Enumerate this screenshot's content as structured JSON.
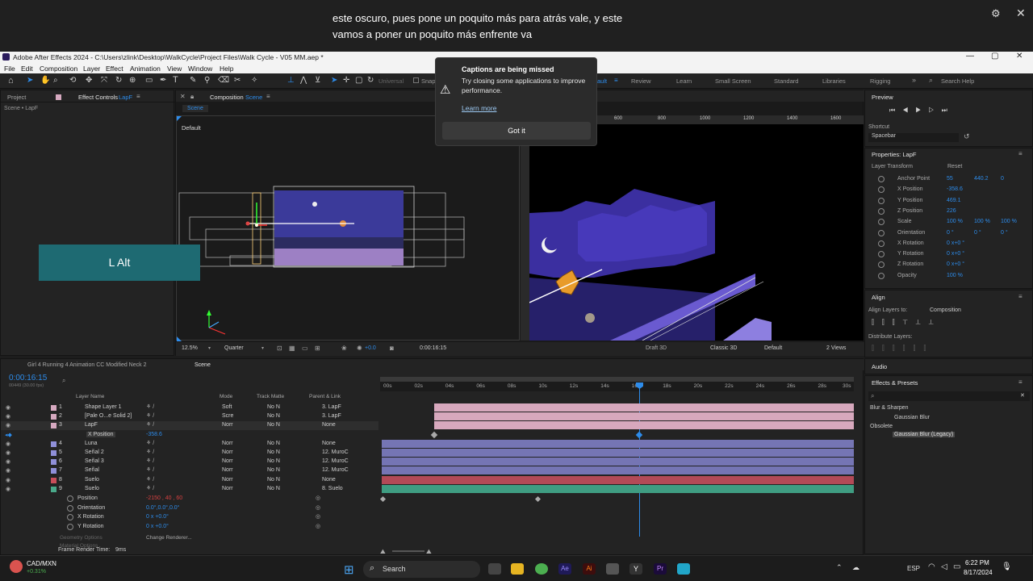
{
  "caption": {
    "line1": "este oscuro, pues pone un poquito más para atrás vale, y este",
    "line2": "vamos a poner un poquito más enfrente va"
  },
  "window": {
    "title": "Adobe After Effects 2024 - C:\\Users\\zlink\\Desktop\\WalkCycle\\Project Files\\Walk Cycle - V05 MM.aep *"
  },
  "menu": [
    "File",
    "Edit",
    "Composition",
    "Layer",
    "Effect",
    "Animation",
    "View",
    "Window",
    "Help"
  ],
  "toolbar": {
    "universal": "Universal",
    "snap": "Snap",
    "workspaces": [
      "ault",
      "Review",
      "Learn",
      "Small Screen",
      "Standard",
      "Libraries",
      "Rigging"
    ],
    "search_placeholder": "Search Help"
  },
  "notification": {
    "title": "Captions are being missed",
    "body": "Try closing some applications to improve performance.",
    "link": "Learn more",
    "button": "Got it"
  },
  "left_panel": {
    "tabs": [
      "Project",
      "Effect Controls"
    ],
    "effect_target": "LapF",
    "subtitle": "Scene • LapF"
  },
  "comp_panel": {
    "tab": "Composition",
    "tab_target": "Scene",
    "breadcrumb": "Scene",
    "view_label": "Default",
    "overlay_key": "L Alt",
    "zoom": "12.5%",
    "resolution": "Quarter",
    "exposure": "+0.0",
    "timecode": "0:00:16:15",
    "renderer_draft": "Draft 3D",
    "renderer": "Classic 3D",
    "camera": "Default",
    "views": "2 Views",
    "ruler_ticks": [
      "600",
      "800",
      "1000",
      "1200",
      "1400",
      "1600"
    ]
  },
  "preview": {
    "title": "Preview",
    "shortcut_label": "Shortcut",
    "shortcut_value": "Spacebar"
  },
  "properties": {
    "title": "Properties: LapF",
    "section": "Layer Transform",
    "reset": "Reset",
    "rows": [
      {
        "name": "Anchor Point",
        "v1": "55",
        "v2": "440.2",
        "v3": "0"
      },
      {
        "name": "X Position",
        "v1": "-358.6",
        "v2": "",
        "v3": ""
      },
      {
        "name": "Y Position",
        "v1": "469.1",
        "v2": "",
        "v3": ""
      },
      {
        "name": "Z Position",
        "v1": "226",
        "v2": "",
        "v3": ""
      },
      {
        "name": "Scale",
        "v1": "100 %",
        "v2": "100 %",
        "v3": "100 %"
      },
      {
        "name": "Orientation",
        "v1": "0 °",
        "v2": "0 °",
        "v3": "0 °"
      },
      {
        "name": "X Rotation",
        "v1": "0 x+0 °",
        "v2": "",
        "v3": ""
      },
      {
        "name": "Y Rotation",
        "v1": "0 x+0 °",
        "v2": "",
        "v3": ""
      },
      {
        "name": "Z Rotation",
        "v1": "0 x+0 °",
        "v2": "",
        "v3": ""
      },
      {
        "name": "Opacity",
        "v1": "100 %",
        "v2": "",
        "v3": ""
      }
    ]
  },
  "align": {
    "title": "Align",
    "align_to_label": "Align Layers to:",
    "align_to_value": "Composition",
    "distribute": "Distribute Layers:"
  },
  "audio": {
    "title": "Audio"
  },
  "effects": {
    "title": "Effects & Presets",
    "search": "",
    "tree": [
      {
        "label": "Blur & Sharpen",
        "indent": 0
      },
      {
        "label": "Gaussian Blur",
        "indent": 1
      },
      {
        "label": "Obsolete",
        "indent": 0
      },
      {
        "label": "Gaussian Blur (Legacy)",
        "indent": 1
      }
    ]
  },
  "timeline": {
    "tabs": [
      "Girl 4 Running 4 Animation CC Modified Neck 2",
      "Scene"
    ],
    "timecode": "0:00:16:15",
    "frames": "00449 (30.00 fps)",
    "headers": {
      "layer_name": "Layer Name",
      "mode": "Mode",
      "track_matte": "Track Matte",
      "parent": "Parent & Link"
    },
    "ruler": [
      "00s",
      "02s",
      "04s",
      "06s",
      "08s",
      "10s",
      "12s",
      "14s",
      "16s",
      "18s",
      "20s",
      "22s",
      "24s",
      "26s",
      "28s",
      "30s"
    ],
    "layers": [
      {
        "num": "1",
        "name": "Shape Layer 1",
        "mode": "Soft",
        "matte": "No N",
        "parent": "3. LapF",
        "color": "#d6a9c0"
      },
      {
        "num": "2",
        "name": "[Pale O...e Solid 2]",
        "mode": "Scre",
        "matte": "No N",
        "parent": "3. LapF",
        "color": "#d6a9c0"
      },
      {
        "num": "3",
        "name": "LapF",
        "mode": "Norr",
        "matte": "No N",
        "parent": "None",
        "color": "#d6a9c0"
      },
      {
        "num": "",
        "name": "X Position",
        "mode": "",
        "matte": "",
        "parent": "",
        "color": ""
      },
      {
        "num": "4",
        "name": "Luna",
        "mode": "Norr",
        "matte": "No N",
        "parent": "None",
        "color": "#8f8fd8"
      },
      {
        "num": "5",
        "name": "Señal 2",
        "mode": "Norr",
        "matte": "No N",
        "parent": "12. MuroC",
        "color": "#8f8fd8"
      },
      {
        "num": "6",
        "name": "Señal 3",
        "mode": "Norr",
        "matte": "No N",
        "parent": "12. MuroC",
        "color": "#8f8fd8"
      },
      {
        "num": "7",
        "name": "Señal",
        "mode": "Norr",
        "matte": "No N",
        "parent": "12. MuroC",
        "color": "#8f8fd8"
      },
      {
        "num": "8",
        "name": "Suelo",
        "mode": "Norr",
        "matte": "No N",
        "parent": "None",
        "color": "#c94e5a"
      },
      {
        "num": "9",
        "name": "Suelo",
        "mode": "Norr",
        "matte": "No N",
        "parent": "8. Suelo",
        "color": "#4aa98a"
      }
    ],
    "xpos_value": "-358.6",
    "sub_props": [
      {
        "name": "Position",
        "value": "-2150 , 40 , 60"
      },
      {
        "name": "Orientation",
        "value": "0.0°,0.0°,0.0°"
      },
      {
        "name": "X Rotation",
        "value": "0 x +0.0°"
      },
      {
        "name": "Y Rotation",
        "value": "0 x +0.0°"
      }
    ],
    "geometry": "Geometry Options",
    "change_renderer": "Change Renderer...",
    "material": "Material Options",
    "render_time_label": "Frame Render Time:",
    "render_time_value": "9ms"
  },
  "taskbar": {
    "stock_name": "CAD/MXN",
    "stock_change": "+0.31%",
    "search": "Search",
    "lang": "ESP",
    "time": "6:22 PM",
    "date": "8/17/2024"
  },
  "colors": {
    "accent": "#2d8ceb",
    "playhead": "#2d8ceb",
    "bar_pink": "#d7a8bd",
    "bar_purple": "#7575b4",
    "bar_red": "#b34a57",
    "bar_teal": "#3f9d82"
  }
}
